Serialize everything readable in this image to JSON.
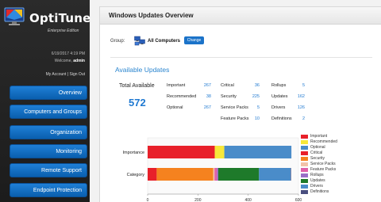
{
  "app": {
    "name": "OptiTune",
    "edition": "Enterprise Edition",
    "datetime": "6/19/2017 4:19 PM",
    "welcome_prefix": "Welcome,",
    "username": "admin",
    "my_account": "My Account",
    "separator": "|",
    "sign_out": "Sign Out"
  },
  "nav": [
    {
      "label": "Overview"
    },
    {
      "label": "Computers and Groups"
    },
    {
      "label": "Organization"
    },
    {
      "label": "Monitoring"
    },
    {
      "label": "Remote Support"
    },
    {
      "label": "Endpoint Protection"
    }
  ],
  "page": {
    "title": "Windows Updates Overview",
    "group_label": "Group:",
    "group_name": "All Computers",
    "change_label": "Change",
    "section_title": "Available Updates",
    "total_label": "Total Available",
    "total_value": "572"
  },
  "stats": [
    {
      "label": "Important",
      "value": "267"
    },
    {
      "label": "Recommended",
      "value": "38"
    },
    {
      "label": "Optional",
      "value": "267"
    },
    {
      "label": "Critical",
      "value": "36"
    },
    {
      "label": "Security",
      "value": "225"
    },
    {
      "label": "Service Packs",
      "value": "5"
    },
    {
      "label": "Feature Packs",
      "value": "10"
    },
    {
      "label": "Rollups",
      "value": "5"
    },
    {
      "label": "Updates",
      "value": "162"
    },
    {
      "label": "Drivers",
      "value": "126"
    },
    {
      "label": "Definitions",
      "value": "2"
    }
  ],
  "chart_data": {
    "type": "bar",
    "orientation": "horizontal",
    "stacked": true,
    "categories": [
      "Importance",
      "Category"
    ],
    "xlim": [
      0,
      600
    ],
    "xticks": [
      "0",
      "200",
      "400",
      "600"
    ],
    "series": [
      {
        "name": "Important",
        "color": "#e8202a",
        "values": [
          267,
          0
        ]
      },
      {
        "name": "Recommended",
        "color": "#f7e83a",
        "values": [
          38,
          0
        ]
      },
      {
        "name": "Optional",
        "color": "#4a8cc9",
        "values": [
          267,
          0
        ]
      },
      {
        "name": "Critical",
        "color": "#e8202a",
        "values": [
          0,
          36
        ]
      },
      {
        "name": "Security",
        "color": "#f5821f",
        "values": [
          0,
          225
        ]
      },
      {
        "name": "Service Packs",
        "color": "#f2c2a8",
        "values": [
          0,
          5
        ]
      },
      {
        "name": "Feature Packs",
        "color": "#e060a8",
        "values": [
          0,
          10
        ]
      },
      {
        "name": "Rollups",
        "color": "#9a6fc7",
        "values": [
          0,
          5
        ]
      },
      {
        "name": "Updates",
        "color": "#1e7a2a",
        "values": [
          0,
          162
        ]
      },
      {
        "name": "Drivers",
        "color": "#4a8cc9",
        "values": [
          0,
          126
        ]
      },
      {
        "name": "Definitions",
        "color": "#4a4f80",
        "values": [
          0,
          2
        ]
      }
    ],
    "legend_position": "right"
  }
}
